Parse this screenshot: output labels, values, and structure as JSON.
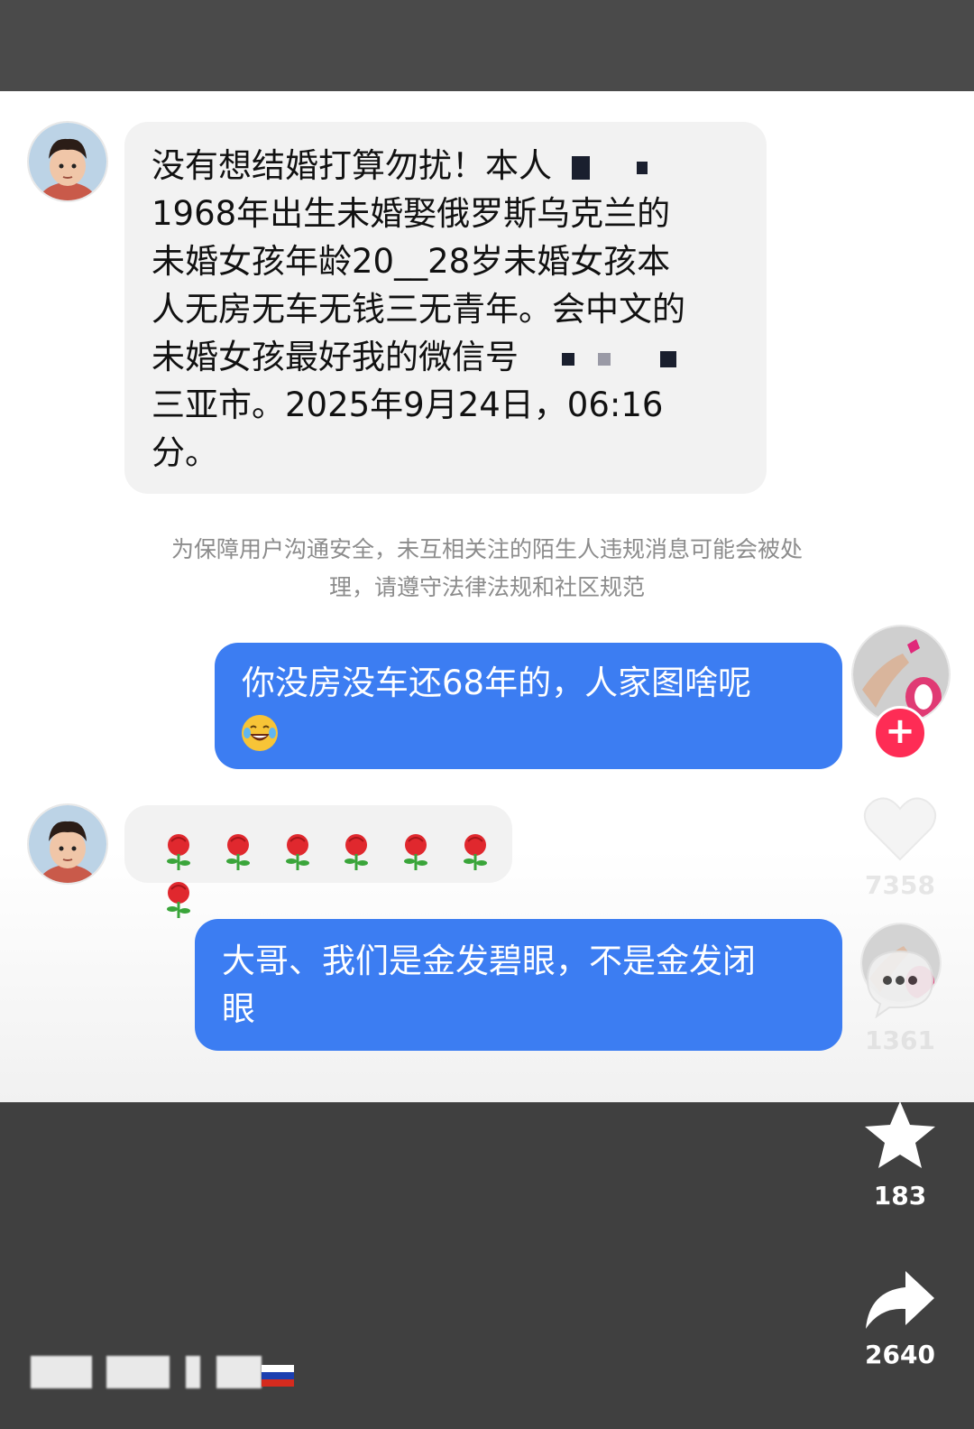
{
  "chat": {
    "message1_lines": [
      "没有想结婚打算勿扰！本人",
      "1968年出生未婚娶俄罗斯乌克兰的",
      "未婚女孩年龄20__28岁未婚女孩本",
      "人无房无车无钱三无青年。会中文的",
      "未婚女孩最好我的微信号",
      "三亚市。2025年9月24日，06:16",
      "分。"
    ],
    "notice_line1": "为保障用户沟通安全，未互相关注的陌生人违规消息可能会被处",
    "notice_line2_a": "理，请遵守",
    "notice_line2_link": "法律法规和社区规范",
    "reply1_line1": "你没房没车还68年的，人家图啥呢",
    "reply1_emoji": "laughing-crying-emoji",
    "roses_count": 7,
    "reply2_line1": "大哥、我们是金发碧眼，不是金发闭",
    "reply2_line2": "眼"
  },
  "side": {
    "like_count": "7358",
    "comment_count": "1361",
    "favorite_count": "183",
    "share_count": "2640"
  },
  "colors": {
    "sent_bubble": "#3c7df2",
    "received_bubble": "#f2f2f2",
    "follow_badge": "#fe2c55"
  },
  "icons": [
    "heart-icon",
    "comment-icon",
    "star-icon",
    "share-icon",
    "plus-icon",
    "rose-icon"
  ]
}
